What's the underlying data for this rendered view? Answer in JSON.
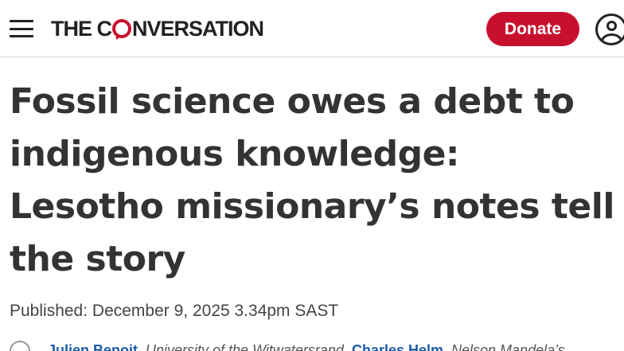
{
  "header": {
    "logo_prefix": "THE C",
    "logo_suffix": "NVERSATION",
    "donate_label": "Donate",
    "accent_color": "#c8102e",
    "icons": [
      "menu-icon",
      "account-icon"
    ]
  },
  "article": {
    "title_lines": [
      "Fossil science owes a debt to",
      "indigenous knowledge:",
      "Lesotho missionary’s notes tell",
      "the story"
    ],
    "published": "Published: December 9, 2025 3.34pm SAST",
    "byline": {
      "author1": "Julien Benoit",
      "affiliation1": ", University of the Witwatersrand, ",
      "author2": "Charles Helm",
      "affiliation2": ", Nelson Mandela’s"
    }
  }
}
